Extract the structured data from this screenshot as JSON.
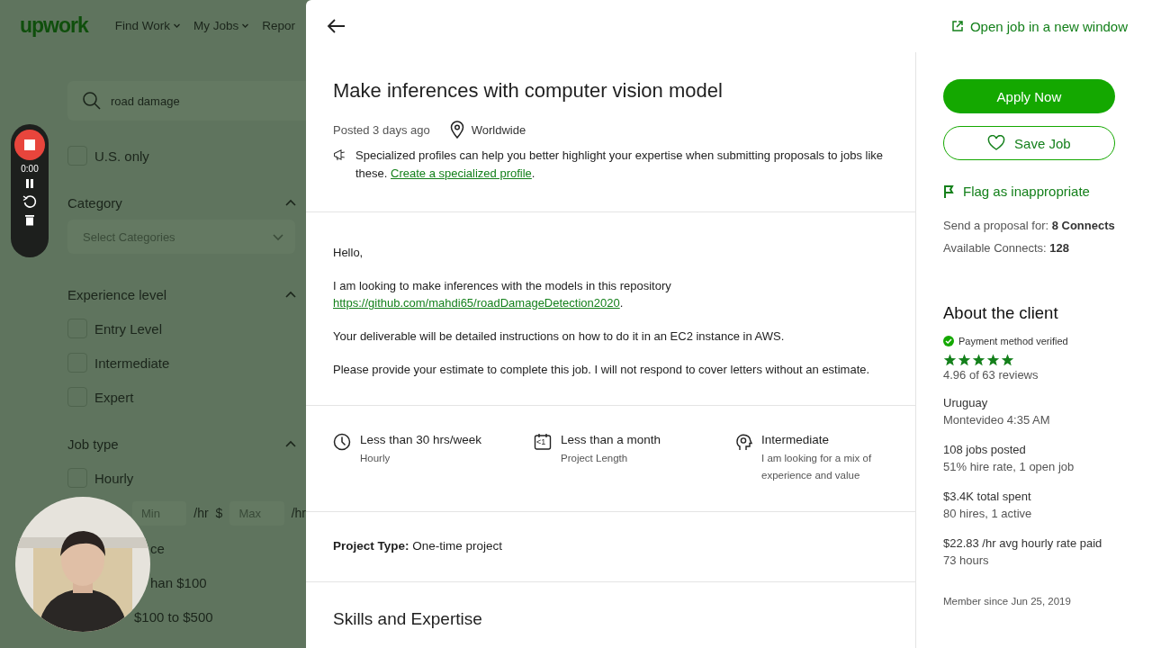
{
  "nav": {
    "logo": "upwork",
    "items": [
      {
        "label": "Find Work",
        "caret": true
      },
      {
        "label": "My Jobs",
        "caret": true
      },
      {
        "label": "Repor",
        "caret": false
      }
    ]
  },
  "filters": [
    {
      "kind": "search",
      "value": "road damage"
    },
    {
      "kind": "checkbox",
      "label": "U.S. only",
      "checked": false
    },
    {
      "kind": "heading",
      "label": "Category",
      "expanded": true
    },
    {
      "kind": "select",
      "placeholder": "Select Categories"
    },
    {
      "kind": "heading",
      "label": "Experience level",
      "expanded": true
    },
    {
      "kind": "checkbox",
      "label": "Entry Level",
      "checked": false
    },
    {
      "kind": "checkbox",
      "label": "Intermediate",
      "checked": false
    },
    {
      "kind": "checkbox",
      "label": "Expert",
      "checked": false
    },
    {
      "kind": "heading",
      "label": "Job type",
      "expanded": true
    },
    {
      "kind": "checkbox",
      "label": "Hourly",
      "checked": false
    },
    {
      "kind": "rate",
      "min_placeholder": "Min",
      "min_unit": "/hr",
      "currency": "$",
      "max_placeholder": "Max",
      "max_unit": "/hr"
    },
    {
      "kind": "partial",
      "label": "ce"
    },
    {
      "kind": "partial",
      "label": "han $100"
    },
    {
      "kind": "partial",
      "label": "$100 to $500"
    }
  ],
  "recorder": {
    "time": "0:00"
  },
  "job": {
    "open_link": "Open job in a new window",
    "title": "Make inferences with computer vision model",
    "posted": "Posted 3 days ago",
    "location": "Worldwide",
    "notice": "Specialized profiles can help you better highlight your expertise when submitting proposals to jobs like these.",
    "notice_link": "Create a specialized profile",
    "notice_end": ".",
    "description": [
      {
        "text": "Hello,"
      },
      {
        "text": "I am looking to make inferences with the models in this repository",
        "link": "https://github.com/mahdi65/roadDamageDetection2020",
        "link_end": "."
      },
      {
        "text": "Your deliverable will be detailed instructions on how to do it in an EC2 instance in AWS."
      },
      {
        "text": "Please provide your estimate to complete this job. I will not respond to cover letters without an estimate."
      }
    ],
    "features": [
      {
        "kind": "clock",
        "title": "Less than 30 hrs/week",
        "sub": "Hourly"
      },
      {
        "kind": "calendar",
        "badge": "<1",
        "title": "Less than a month",
        "sub": "Project Length"
      },
      {
        "kind": "brain",
        "title": "Intermediate",
        "sub": "I am looking for a mix of experience and value"
      }
    ],
    "project_type": "**Project Type:** One-time project",
    "skills_heading": "Skills and Expertise"
  },
  "side": {
    "apply": "Apply Now",
    "save": "Save Job",
    "flag": "Flag as inappropriate",
    "proposal": "Send a proposal for: **8 Connects**",
    "available": "Available Connects: **128**",
    "about": "About the client",
    "payment": "Payment method verified",
    "verified": true,
    "stars": 5,
    "reviews": "4.96 of 63 reviews",
    "stats": [
      {
        "main": "Uruguay",
        "sub": "Montevideo 4:35 AM"
      },
      {
        "main": "108 jobs posted",
        "sub": "51% hire rate, 1 open job"
      },
      {
        "main": "$3.4K total spent",
        "sub": "80 hires, 1 active"
      },
      {
        "main": "$22.83 /hr avg hourly rate paid",
        "sub": "73 hours"
      }
    ],
    "member": "Member since Jun 25, 2019"
  }
}
